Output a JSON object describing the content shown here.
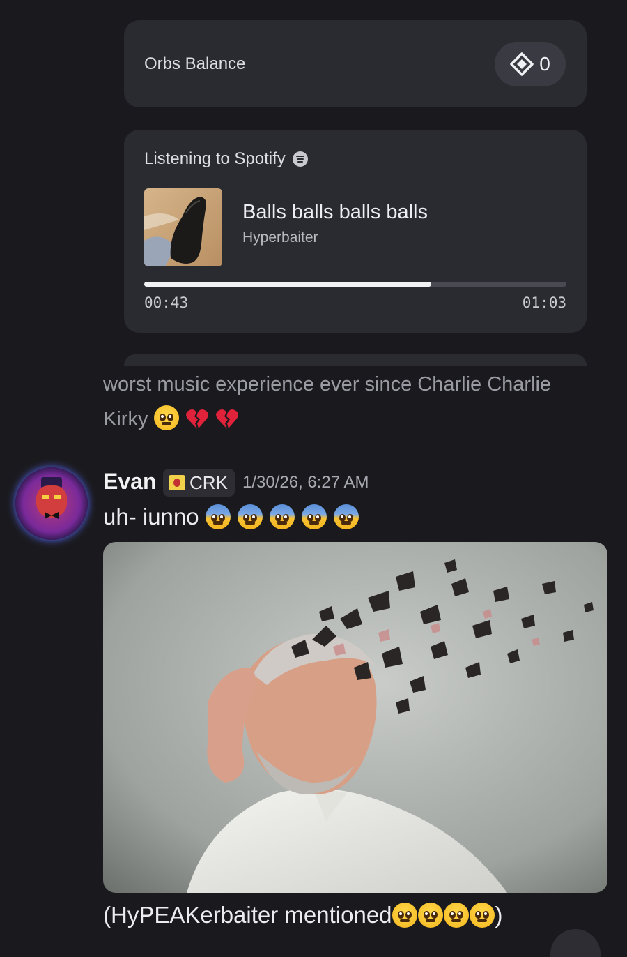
{
  "orbs": {
    "label": "Orbs Balance",
    "balance": "0",
    "icon": "orb-icon"
  },
  "spotify": {
    "heading": "Listening to Spotify",
    "icon": "spotify-icon",
    "track_title": "Balls balls balls balls",
    "artist": "Hyperbaiter",
    "elapsed": "00:43",
    "duration": "01:03",
    "progress": 0.68
  },
  "previous_message": {
    "text": "worst music experience ever since Charlie Charlie Kirky",
    "emojis": [
      "pleading-face",
      "broken-heart",
      "broken-heart"
    ]
  },
  "message": {
    "username": "Evan",
    "tag": "CRK",
    "timestamp": "1/30/26, 6:27 AM",
    "text": "uh- iunno",
    "emojis": [
      "fearful-face",
      "fearful-face",
      "fearful-face",
      "fearful-face",
      "fearful-face"
    ],
    "image": "shattering-head-photo",
    "caption_start": "(HyPEAKerbaiter mentioned",
    "caption_emojis": [
      "pleading-face",
      "pleading-face",
      "pleading-face",
      "pleading-face"
    ],
    "caption_end": ")"
  },
  "colors": {
    "background": "#1a1a1e",
    "card": "#2a2a31",
    "accent": "#f2f2f4"
  }
}
